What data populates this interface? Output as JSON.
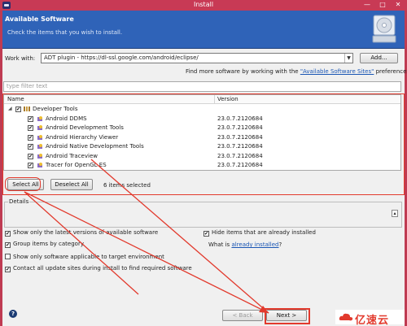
{
  "window": {
    "title": "Install",
    "minimize": "—",
    "maximize": "□",
    "close": "✕"
  },
  "banner": {
    "heading": "Available Software",
    "subtitle": "Check the items that you wish to install."
  },
  "workwith": {
    "label": "Work with:",
    "value": "ADT plugin - https://dl-ssl.google.com/android/eclipse/",
    "add_button": "Add...",
    "hint_prefix": "Find more software by working with the ",
    "hint_link": "\"Available Software Sites\"",
    "hint_suffix": " preferences."
  },
  "filter": {
    "placeholder": "type filter text"
  },
  "tree": {
    "columns": [
      "Name",
      "Version"
    ],
    "category": {
      "name": "Developer Tools",
      "checked": true
    },
    "items": [
      {
        "name": "Android DDMS",
        "version": "23.0.7.2120684"
      },
      {
        "name": "Android Development Tools",
        "version": "23.0.7.2120684"
      },
      {
        "name": "Android Hierarchy Viewer",
        "version": "23.0.7.2120684"
      },
      {
        "name": "Android Native Development Tools",
        "version": "23.0.7.2120684"
      },
      {
        "name": "Android Traceview",
        "version": "23.0.7.2120684"
      },
      {
        "name": "Tracer for OpenGL ES",
        "version": "23.0.7.2120684"
      }
    ]
  },
  "selection": {
    "select_all": "Select All",
    "deselect_all": "Deselect All",
    "status": "6 items selected"
  },
  "details": {
    "legend": "Details"
  },
  "options": {
    "latest_versions": "Show only the latest versions of available software",
    "group_by_category": "Group items by category",
    "target_env": "Show only software applicable to target environment",
    "contact_sites": "Contact all update sites during install to find required software",
    "hide_installed": "Hide items that are already installed",
    "what_is_prefix": "What is ",
    "what_is_link": "already installed",
    "what_is_suffix": "?"
  },
  "footer": {
    "help": "?",
    "back": "< Back",
    "next": "Next >"
  },
  "watermark": {
    "text": "亿速云"
  },
  "colors": {
    "titlebar": "#c83a55",
    "banner": "#2f63b8",
    "annotation": "#e23a2d",
    "link": "#1a56b4"
  }
}
